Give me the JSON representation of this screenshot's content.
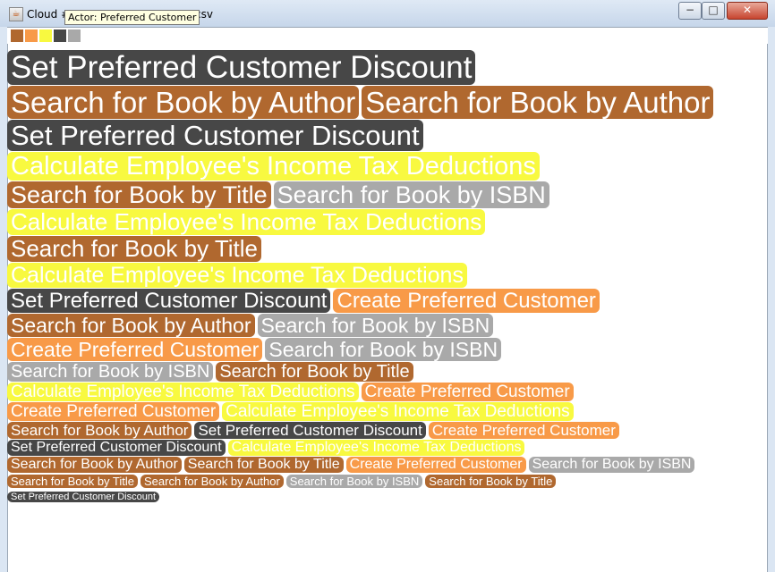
{
  "window": {
    "title_prefix": "Cloud #",
    "title_suffix": "csv",
    "tooltip": "Actor: Preferred Customer",
    "icon": "java-icon",
    "controls": {
      "minimize": "−",
      "maximize": "□",
      "close": "✕"
    }
  },
  "colors": {
    "dark": "#474747",
    "brown": "#b0682f",
    "yellow": "#f8f940",
    "grey": "#a9a9a9",
    "orange": "#f89a48"
  },
  "legend": [
    "brown",
    "orange",
    "yellow",
    "dark",
    "grey"
  ],
  "rows": [
    {
      "size": 35,
      "items": [
        {
          "text": "Set Preferred Customer Discount",
          "color": "dark"
        }
      ]
    },
    {
      "size": 33,
      "items": [
        {
          "text": "Search for Book by Author",
          "color": "brown"
        },
        {
          "text": "Search for Book by Author",
          "color": "brown"
        }
      ]
    },
    {
      "size": 31,
      "items": [
        {
          "text": "Set Preferred Customer Discount",
          "color": "dark"
        }
      ]
    },
    {
      "size": 29,
      "items": [
        {
          "text": "Calculate Employee's Income Tax Deductions",
          "color": "yellow"
        }
      ]
    },
    {
      "size": 27,
      "items": [
        {
          "text": "Search for Book by Title",
          "color": "brown"
        },
        {
          "text": "Search for Book by ISBN",
          "color": "grey"
        }
      ]
    },
    {
      "size": 26,
      "items": [
        {
          "text": "Calculate Employee's Income Tax Deductions",
          "color": "yellow"
        }
      ]
    },
    {
      "size": 26,
      "items": [
        {
          "text": "Search for Book by Title",
          "color": "brown"
        }
      ]
    },
    {
      "size": 25,
      "items": [
        {
          "text": "Calculate Employee's Income Tax Deductions",
          "color": "yellow"
        }
      ]
    },
    {
      "size": 24,
      "items": [
        {
          "text": "Set Preferred Customer Discount",
          "color": "dark"
        },
        {
          "text": "Create Preferred Customer",
          "color": "orange"
        }
      ]
    },
    {
      "size": 23,
      "items": [
        {
          "text": "Search for Book by Author",
          "color": "brown"
        },
        {
          "text": "Search for Book by ISBN",
          "color": "grey"
        }
      ]
    },
    {
      "size": 23,
      "items": [
        {
          "text": "Create Preferred Customer",
          "color": "orange"
        },
        {
          "text": "Search for Book by ISBN",
          "color": "grey"
        }
      ]
    },
    {
      "size": 20,
      "items": [
        {
          "text": "Search for Book by ISBN",
          "color": "grey"
        },
        {
          "text": "Search for Book by Title",
          "color": "brown"
        }
      ]
    },
    {
      "size": 19,
      "items": [
        {
          "text": "Calculate Employee's Income Tax Deductions",
          "color": "yellow"
        },
        {
          "text": "Create Preferred Customer",
          "color": "orange"
        }
      ]
    },
    {
      "size": 19,
      "items": [
        {
          "text": "Create Preferred Customer",
          "color": "orange"
        },
        {
          "text": "Calculate Employee's Income Tax Deductions",
          "color": "yellow"
        }
      ]
    },
    {
      "size": 17,
      "items": [
        {
          "text": "Search for Book by Author",
          "color": "brown"
        },
        {
          "text": "Set Preferred Customer Discount",
          "color": "dark"
        },
        {
          "text": "Create Preferred Customer",
          "color": "orange"
        }
      ]
    },
    {
      "size": 16,
      "items": [
        {
          "text": "Set Preferred Customer Discount",
          "color": "dark"
        },
        {
          "text": "Calculate Employee's Income Tax Deductions",
          "color": "yellow"
        }
      ]
    },
    {
      "size": 16,
      "items": [
        {
          "text": "Search for Book by Author",
          "color": "brown"
        },
        {
          "text": "Search for Book by Title",
          "color": "brown"
        },
        {
          "text": "Create Preferred Customer",
          "color": "orange"
        },
        {
          "text": "Search for Book by ISBN",
          "color": "grey"
        }
      ]
    },
    {
      "size": 13,
      "items": [
        {
          "text": "Search for Book by Title",
          "color": "brown"
        },
        {
          "text": "Search for Book by Author",
          "color": "brown"
        },
        {
          "text": "Search for Book by ISBN",
          "color": "grey"
        },
        {
          "text": "Search for Book by Title",
          "color": "brown"
        }
      ]
    },
    {
      "size": 11,
      "items": [
        {
          "text": "Set Preferred Customer Discount",
          "color": "dark"
        }
      ]
    }
  ]
}
